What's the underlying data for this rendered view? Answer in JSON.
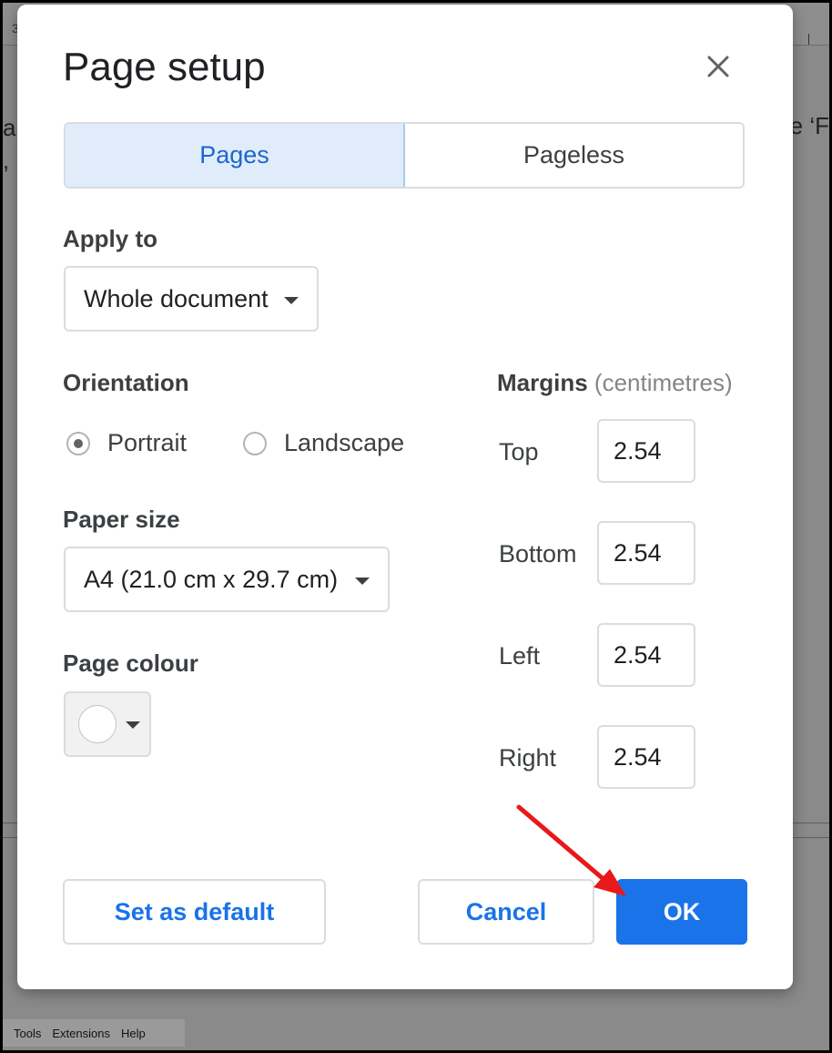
{
  "background": {
    "ruler_number": "3",
    "text_left_1": "a",
    "text_left_2": ",",
    "text_right": "e ‘F",
    "menubar": [
      "Tools",
      "Extensions",
      "Help"
    ]
  },
  "dialog": {
    "title": "Page setup",
    "close_icon": "close-icon",
    "tabs": [
      {
        "label": "Pages",
        "active": true
      },
      {
        "label": "Pageless",
        "active": false
      }
    ],
    "apply_to": {
      "label": "Apply to",
      "value": "Whole document"
    },
    "orientation": {
      "label": "Orientation",
      "options": [
        {
          "label": "Portrait",
          "checked": true
        },
        {
          "label": "Landscape",
          "checked": false
        }
      ]
    },
    "paper_size": {
      "label": "Paper size",
      "value": "A4 (21.0 cm x 29.7 cm)"
    },
    "page_colour": {
      "label": "Page colour",
      "value": "#ffffff"
    },
    "margins": {
      "label": "Margins",
      "unit": "(centimetres)",
      "fields": [
        {
          "label": "Top",
          "value": "2.54"
        },
        {
          "label": "Bottom",
          "value": "2.54"
        },
        {
          "label": "Left",
          "value": "2.54"
        },
        {
          "label": "Right",
          "value": "2.54"
        }
      ]
    },
    "buttons": {
      "set_default": "Set as default",
      "cancel": "Cancel",
      "ok": "OK"
    }
  },
  "colors": {
    "accent": "#1a73e8",
    "active_tab_bg": "#e1ecfb",
    "annotation_arrow": "#e8191a"
  }
}
